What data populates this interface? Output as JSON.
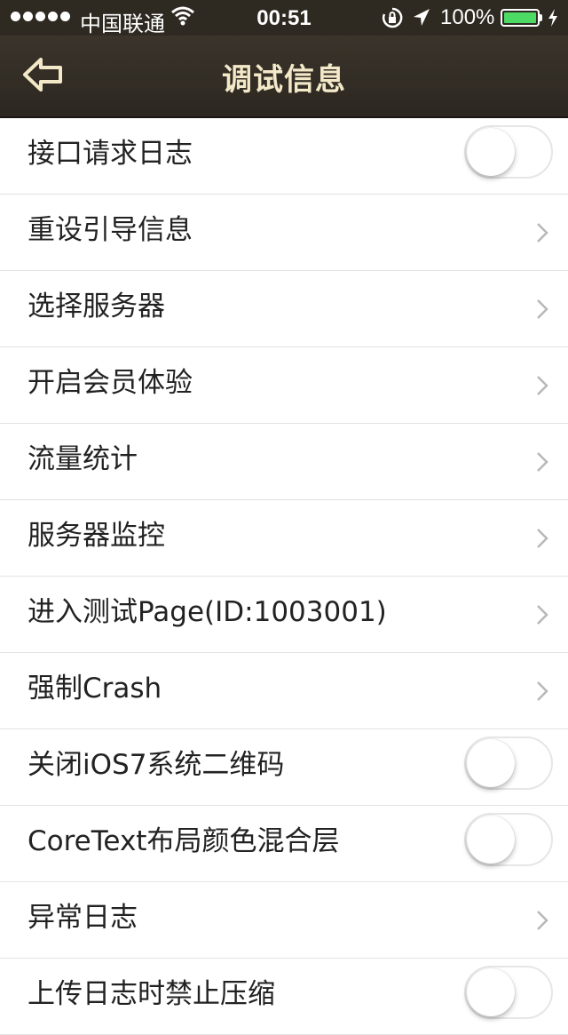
{
  "status_bar": {
    "carrier": "中国联通",
    "time": "00:51",
    "battery": "100%",
    "battery_color": "#4cd964"
  },
  "nav": {
    "title": "调试信息",
    "back_icon": "back-arrow-icon"
  },
  "rows": [
    {
      "label": "接口请求日志",
      "control": "toggle",
      "on": false
    },
    {
      "label": "重设引导信息",
      "control": "chevron"
    },
    {
      "label": "选择服务器",
      "control": "chevron"
    },
    {
      "label": "开启会员体验",
      "control": "chevron"
    },
    {
      "label": "流量统计",
      "control": "chevron"
    },
    {
      "label": "服务器监控",
      "control": "chevron"
    },
    {
      "label": "进入测试Page(ID:1003001)",
      "control": "chevron"
    },
    {
      "label": "强制Crash",
      "control": "chevron"
    },
    {
      "label": "关闭iOS7系统二维码",
      "control": "toggle",
      "on": false
    },
    {
      "label": "CoreText布局颜色混合层",
      "control": "toggle",
      "on": false
    },
    {
      "label": "异常日志",
      "control": "chevron"
    },
    {
      "label": "上传日志时禁止压缩",
      "control": "toggle",
      "on": false
    }
  ]
}
